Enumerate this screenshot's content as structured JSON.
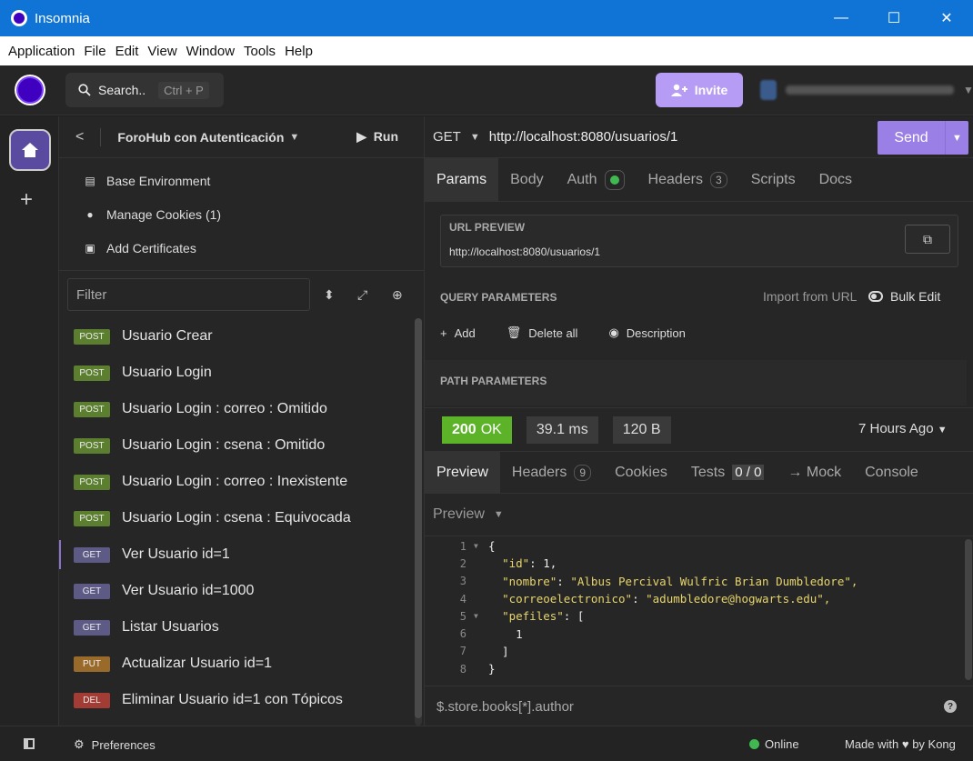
{
  "window": {
    "title": "Insomnia",
    "minimize": "—",
    "maximize": "☐",
    "close": "✕"
  },
  "menu": [
    "Application",
    "File",
    "Edit",
    "View",
    "Window",
    "Tools",
    "Help"
  ],
  "header": {
    "search_label": "Search..",
    "search_shortcut": "Ctrl + P",
    "invite_label": "Invite"
  },
  "sidebar": {
    "project": "ForoHub con Autenticación",
    "run_label": "Run",
    "links": [
      "Base Environment",
      "Manage Cookies (1)",
      "Add Certificates"
    ],
    "filter_placeholder": "Filter",
    "requests": [
      {
        "method": "POST",
        "name": "Usuario Crear"
      },
      {
        "method": "POST",
        "name": "Usuario Login"
      },
      {
        "method": "POST",
        "name": "Usuario Login : correo : Omitido"
      },
      {
        "method": "POST",
        "name": "Usuario Login : csena : Omitido"
      },
      {
        "method": "POST",
        "name": "Usuario Login : correo : Inexistente"
      },
      {
        "method": "POST",
        "name": "Usuario Login : csena : Equivocada"
      },
      {
        "method": "GET",
        "name": "Ver Usuario id=1"
      },
      {
        "method": "GET",
        "name": "Ver Usuario id=1000"
      },
      {
        "method": "GET",
        "name": "Listar Usuarios"
      },
      {
        "method": "PUT",
        "name": "Actualizar Usuario id=1"
      },
      {
        "method": "DEL",
        "name": "Eliminar Usuario id=1 con Tópicos"
      }
    ]
  },
  "request": {
    "method": "GET",
    "url": "http://localhost:8080/usuarios/1",
    "send_label": "Send",
    "tabs": {
      "params": "Params",
      "body": "Body",
      "auth": "Auth",
      "headers": "Headers",
      "headers_count": "3",
      "scripts": "Scripts",
      "docs": "Docs"
    },
    "url_preview_label": "URL PREVIEW",
    "url_preview": "http://localhost:8080/usuarios/1",
    "query_params_label": "QUERY PARAMETERS",
    "import_from_url": "Import from URL",
    "bulk_edit": "Bulk Edit",
    "add": "Add",
    "delete_all": "Delete all",
    "description": "Description",
    "path_params_label": "PATH PARAMETERS"
  },
  "response": {
    "status_code": "200",
    "status_text": "OK",
    "time": "39.1 ms",
    "size": "120 B",
    "ago": "7 Hours Ago",
    "tabs": {
      "preview": "Preview",
      "headers": "Headers",
      "headers_count": "9",
      "cookies": "Cookies",
      "tests": "Tests",
      "tests_count": "0 / 0",
      "mock": "→ Mock",
      "console": "Console"
    },
    "preview_mode": "Preview",
    "body_lines": [
      {
        "n": "1",
        "text": "{"
      },
      {
        "n": "2",
        "key": "\"id\"",
        "val": " 1,"
      },
      {
        "n": "3",
        "key": "\"nombre\"",
        "val": " \"Albus Percival Wulfric Brian Dumbledore\","
      },
      {
        "n": "4",
        "key": "\"correoelectronico\"",
        "val": " \"adumbledore@hogwarts.edu\","
      },
      {
        "n": "5",
        "key": "\"pefiles\"",
        "val": " ["
      },
      {
        "n": "6",
        "text": "    1"
      },
      {
        "n": "7",
        "text": "  ]"
      },
      {
        "n": "8",
        "text": "}"
      }
    ],
    "jsonpath_placeholder": "$.store.books[*].author"
  },
  "statusbar": {
    "preferences": "Preferences",
    "online": "Online",
    "made_with": "Made with ♥ by Kong"
  },
  "colors": {
    "accent": "#9a7fe6",
    "ok": "#5cb328",
    "post": "#5b7f2f",
    "get": "#5e5a86",
    "put": "#9a6a2a",
    "del": "#a33c35"
  }
}
